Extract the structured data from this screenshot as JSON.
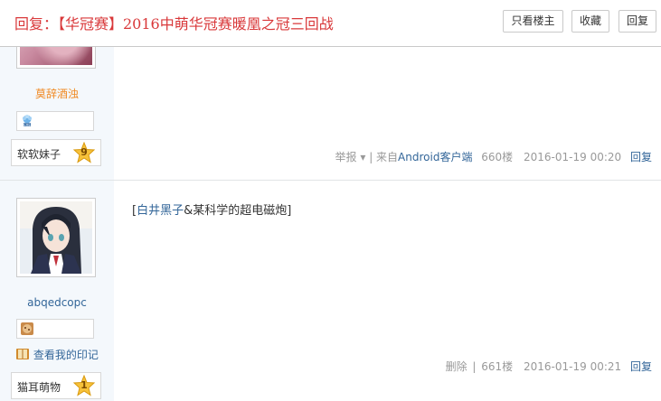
{
  "header": {
    "title": "回复：【华冠赛】2016中萌华冠赛暖凰之冠三回战",
    "buttons": {
      "only_host": "只看楼主",
      "favorite": "收藏",
      "reply": "回复"
    }
  },
  "posts": [
    {
      "username": "莫辞酒浊",
      "username_color": "#f08a24",
      "group_label": "软软妹子",
      "level": "9",
      "report_label": "举报",
      "report_arrow": "▾",
      "source_prefix": "| 来自",
      "source_link": "Android客户端",
      "floor": "660楼",
      "datetime": "2016-01-19 00:20",
      "reply_label": "回复"
    },
    {
      "username": "abqedcopc",
      "username_color": "#336699",
      "yinji_label": "查看我的印记",
      "group_label": "猫耳萌物",
      "level": "1",
      "content_open": "[",
      "content_link": "白井黑子",
      "content_rest": "&某科学的超电磁炮]",
      "delete_label": "删除",
      "floor_sep": "|",
      "floor": "661楼",
      "datetime": "2016-01-19 00:21",
      "reply_label": "回复"
    }
  ],
  "icons": {
    "medal_1": "blue-flower-medal-icon",
    "medal_2": "cookie-medal-icon",
    "level_star": "gold-star-icon",
    "yinji": "book-icon"
  },
  "colors": {
    "title": "#d9383a",
    "link": "#336699",
    "sidebar_bg": "#f4f8fc",
    "meta": "#999999"
  }
}
